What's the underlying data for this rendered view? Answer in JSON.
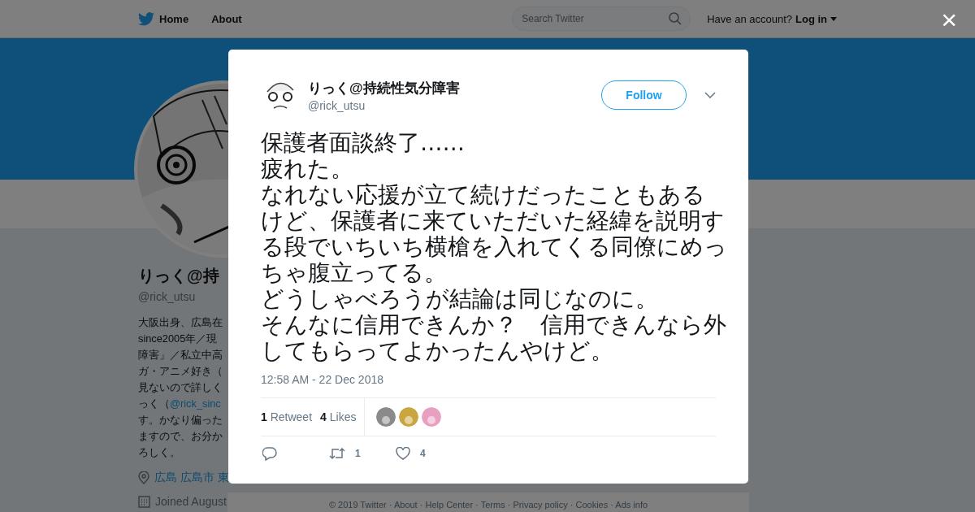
{
  "header": {
    "nav": [
      {
        "label": "Home"
      },
      {
        "label": "About"
      }
    ],
    "search": {
      "placeholder": "Search Twitter"
    },
    "account_prompt": "Have an account?",
    "login": "Log in"
  },
  "profile": {
    "name": "りっく@持",
    "handle": "@rick_utsu",
    "bio_lines": [
      [
        {
          "text": "大阪出身、広島在"
        }
      ],
      [
        {
          "text": "since2005年／現"
        }
      ],
      [
        {
          "text": "障害」／私立中高"
        }
      ],
      [
        {
          "text": "ガ・アニメ好き（"
        }
      ],
      [
        {
          "text": "見ないので詳しく"
        }
      ],
      [
        {
          "text": "っく（"
        },
        {
          "text": "@rick_sinc",
          "link": true
        }
      ],
      [
        {
          "text": "す。かなり偏った"
        }
      ],
      [
        {
          "text": "ますので、お分か"
        }
      ],
      [
        {
          "text": "ろしく。"
        }
      ]
    ],
    "location": "広島 広島市 東",
    "joined": "Joined August"
  },
  "tweet": {
    "name": "りっく@持続性気分障害",
    "handle": "@rick_utsu",
    "follow": "Follow",
    "paragraphs": [
      "保護者面談終了……",
      "疲れた。",
      "なれない応援が立て続けだったこともあるけど、保護者に来ていただいた経緯を説明する段でいちいち横槍を入れてくる同僚にめっちゃ腹立ってる。",
      "どうしゃべろうが結論は同じなのに。",
      "そんなに信用できんか？　信用できんなら外してもらってよかったんやけど。"
    ],
    "time": "12:58 AM - 22 Dec 2018",
    "stats": [
      "**1** Retweet",
      "**4** Likes"
    ],
    "likers": [
      {
        "color": "#8a8a8a"
      },
      {
        "color": "#c9a640"
      },
      {
        "color": "#e8a0c0"
      }
    ],
    "actions": [
      {
        "kind": "reply"
      },
      {
        "kind": "retweet",
        "count": "1"
      },
      {
        "kind": "like",
        "count": "4"
      }
    ]
  },
  "footer": "© 2019 Twitter · About · Help Center · Terms · Privacy policy · Cookies · Ads info",
  "close": "×"
}
